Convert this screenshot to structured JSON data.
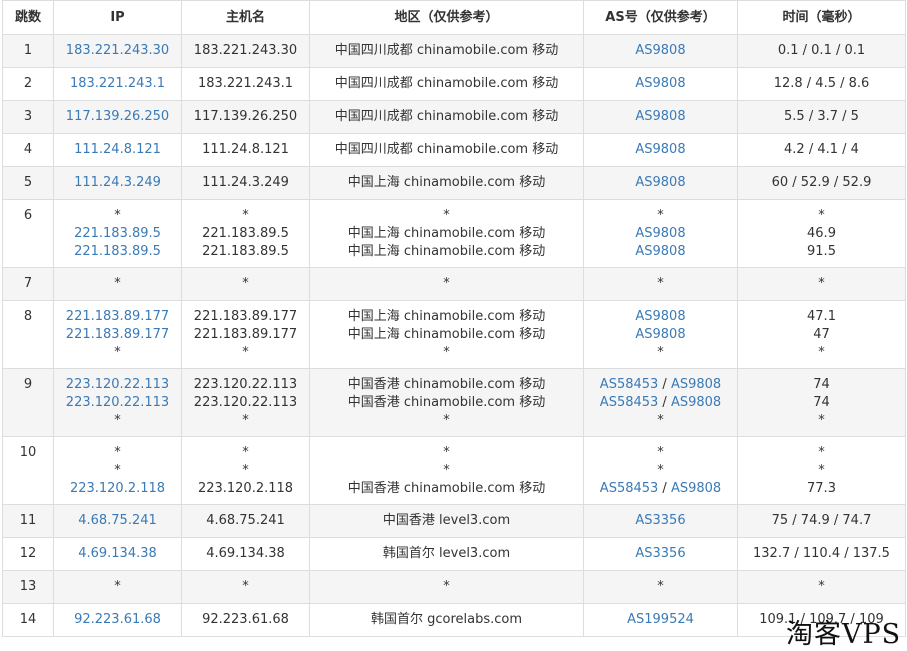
{
  "headers": [
    "跳数",
    "IP",
    "主机名",
    "地区（仅供参考）",
    "AS号（仅供参考）",
    "时间（毫秒）"
  ],
  "rows": [
    {
      "hop": "1",
      "ip": [
        "183.221.243.30"
      ],
      "host": [
        "183.221.243.30"
      ],
      "region": [
        "中国四川成都 chinamobile.com 移动"
      ],
      "as": [
        [
          "AS9808"
        ]
      ],
      "time": [
        "0.1 / 0.1 / 0.1"
      ]
    },
    {
      "hop": "2",
      "ip": [
        "183.221.243.1"
      ],
      "host": [
        "183.221.243.1"
      ],
      "region": [
        "中国四川成都 chinamobile.com 移动"
      ],
      "as": [
        [
          "AS9808"
        ]
      ],
      "time": [
        "12.8 / 4.5 / 8.6"
      ]
    },
    {
      "hop": "3",
      "ip": [
        "117.139.26.250"
      ],
      "host": [
        "117.139.26.250"
      ],
      "region": [
        "中国四川成都 chinamobile.com 移动"
      ],
      "as": [
        [
          "AS9808"
        ]
      ],
      "time": [
        "5.5 / 3.7 / 5"
      ]
    },
    {
      "hop": "4",
      "ip": [
        "111.24.8.121"
      ],
      "host": [
        "111.24.8.121"
      ],
      "region": [
        "中国四川成都 chinamobile.com 移动"
      ],
      "as": [
        [
          "AS9808"
        ]
      ],
      "time": [
        "4.2 / 4.1 / 4"
      ]
    },
    {
      "hop": "5",
      "ip": [
        "111.24.3.249"
      ],
      "host": [
        "111.24.3.249"
      ],
      "region": [
        "中国上海 chinamobile.com 移动"
      ],
      "as": [
        [
          "AS9808"
        ]
      ],
      "time": [
        "60 / 52.9 / 52.9"
      ]
    },
    {
      "hop": "6",
      "ip": [
        "*",
        "221.183.89.5",
        "221.183.89.5"
      ],
      "host": [
        "*",
        "221.183.89.5",
        "221.183.89.5"
      ],
      "region": [
        "*",
        "中国上海 chinamobile.com 移动",
        "中国上海 chinamobile.com 移动"
      ],
      "as": [
        [
          "*"
        ],
        [
          "AS9808"
        ],
        [
          "AS9808"
        ]
      ],
      "time": [
        "*",
        "46.9",
        "91.5"
      ]
    },
    {
      "hop": "7",
      "ip": [
        "*"
      ],
      "host": [
        "*"
      ],
      "region": [
        "*"
      ],
      "as": [
        [
          "*"
        ]
      ],
      "time": [
        "*"
      ]
    },
    {
      "hop": "8",
      "ip": [
        "221.183.89.177",
        "221.183.89.177",
        "*"
      ],
      "host": [
        "221.183.89.177",
        "221.183.89.177",
        "*"
      ],
      "region": [
        "中国上海 chinamobile.com 移动",
        "中国上海 chinamobile.com 移动",
        "*"
      ],
      "as": [
        [
          "AS9808"
        ],
        [
          "AS9808"
        ],
        [
          "*"
        ]
      ],
      "time": [
        "47.1",
        "47",
        "*"
      ]
    },
    {
      "hop": "9",
      "ip": [
        "223.120.22.113",
        "223.120.22.113",
        "*"
      ],
      "host": [
        "223.120.22.113",
        "223.120.22.113",
        "*"
      ],
      "region": [
        "中国香港 chinamobile.com 移动",
        "中国香港 chinamobile.com 移动",
        "*"
      ],
      "as": [
        [
          "AS58453",
          "AS9808"
        ],
        [
          "AS58453",
          "AS9808"
        ],
        [
          "*"
        ]
      ],
      "time": [
        "74",
        "74",
        "*"
      ]
    },
    {
      "hop": "10",
      "ip": [
        "*",
        "*",
        "223.120.2.118"
      ],
      "host": [
        "*",
        "*",
        "223.120.2.118"
      ],
      "region": [
        "*",
        "*",
        "中国香港 chinamobile.com 移动"
      ],
      "as": [
        [
          "*"
        ],
        [
          "*"
        ],
        [
          "AS58453",
          "AS9808"
        ]
      ],
      "time": [
        "*",
        "*",
        "77.3"
      ]
    },
    {
      "hop": "11",
      "ip": [
        "4.68.75.241"
      ],
      "host": [
        "4.68.75.241"
      ],
      "region": [
        "中国香港 level3.com"
      ],
      "as": [
        [
          "AS3356"
        ]
      ],
      "time": [
        "75 / 74.9 / 74.7"
      ]
    },
    {
      "hop": "12",
      "ip": [
        "4.69.134.38"
      ],
      "host": [
        "4.69.134.38"
      ],
      "region": [
        "韩国首尔 level3.com"
      ],
      "as": [
        [
          "AS3356"
        ]
      ],
      "time": [
        "132.7 / 110.4 / 137.5"
      ]
    },
    {
      "hop": "13",
      "ip": [
        "*"
      ],
      "host": [
        "*"
      ],
      "region": [
        "*"
      ],
      "as": [
        [
          "*"
        ]
      ],
      "time": [
        "*"
      ]
    },
    {
      "hop": "14",
      "ip": [
        "92.223.61.68"
      ],
      "host": [
        "92.223.61.68"
      ],
      "region": [
        "韩国首尔 gcorelabs.com"
      ],
      "as": [
        [
          "AS199524"
        ]
      ],
      "time": [
        "109.1 / 109.7 / 109"
      ]
    }
  ],
  "as_separator": " / ",
  "watermark": "淘客VPS",
  "colors": {
    "link": "#3a7ab6",
    "text": "#333333",
    "border": "#dddddd",
    "stripe": "#f5f5f5"
  }
}
